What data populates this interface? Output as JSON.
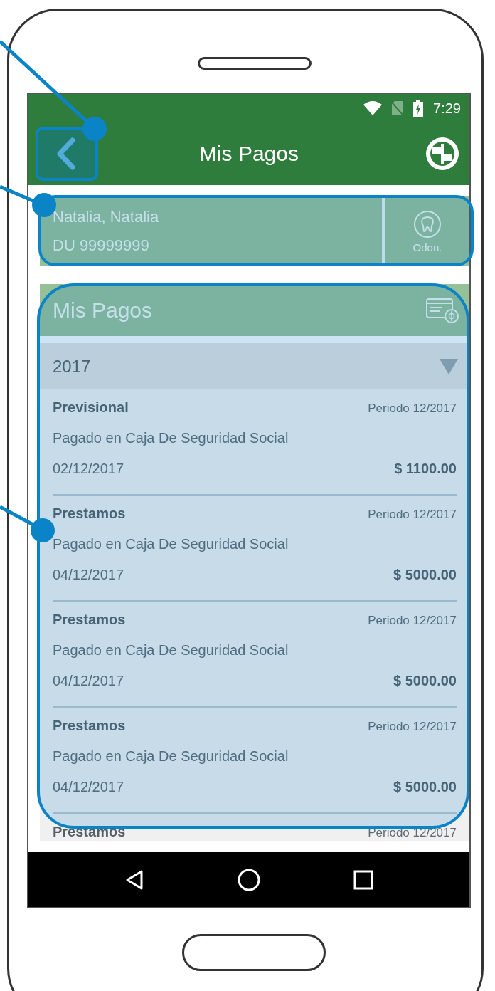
{
  "status_bar": {
    "time": "7:29"
  },
  "header": {
    "title": "Mis Pagos"
  },
  "user": {
    "name": "Natalia, Natalia",
    "document": "DU 99999999",
    "specialty": "Odon."
  },
  "payments": {
    "title": "Mis Pagos",
    "year": "2017",
    "items": [
      {
        "type": "Previsional",
        "period": "Periodo 12/2017",
        "description": "Pagado en Caja De Seguridad Social",
        "date": "02/12/2017",
        "amount": "$ 1100.00"
      },
      {
        "type": "Prestamos",
        "period": "Periodo 12/2017",
        "description": "Pagado en Caja De Seguridad Social",
        "date": "04/12/2017",
        "amount": "$ 5000.00"
      },
      {
        "type": "Prestamos",
        "period": "Periodo 12/2017",
        "description": "Pagado en Caja De Seguridad Social",
        "date": "04/12/2017",
        "amount": "$ 5000.00"
      },
      {
        "type": "Prestamos",
        "period": "Periodo 12/2017",
        "description": "Pagado en Caja De Seguridad Social",
        "date": "04/12/2017",
        "amount": "$ 5000.00"
      },
      {
        "type": "Prestamos",
        "period": "Periodo 12/2017"
      }
    ]
  }
}
